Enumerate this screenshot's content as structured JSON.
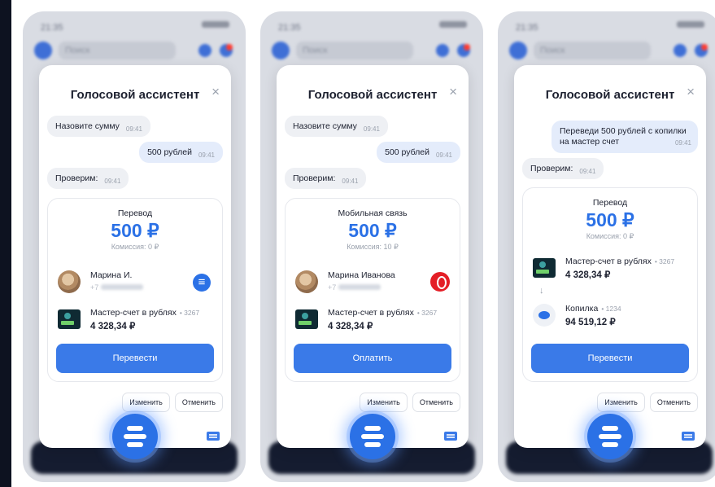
{
  "colors": {
    "accent": "#2b71e6",
    "button": "#3a7ae8",
    "background_frame": "#0d1220"
  },
  "screens": [
    {
      "status_time": "21:35",
      "search_placeholder": "Поиск",
      "title": "Голосовой ассистент",
      "close_icon": "×",
      "messages": [
        {
          "text": "Назовите сумму",
          "time": "09:41",
          "from": "assistant"
        },
        {
          "text": "500 рублей",
          "time": "09:41",
          "from": "user"
        },
        {
          "text": "Проверим:",
          "time": "09:41",
          "from": "assistant"
        }
      ],
      "card": {
        "heading": "Перевод",
        "amount": "500 ₽",
        "fee": "Комиссия: 0 ₽",
        "recipient_name": "Марина И.",
        "recipient_phone_prefix": "+7",
        "account_name": "Мастер-счет в рублях",
        "account_mask": "• 3267",
        "account_balance": "4 328,34 ₽"
      },
      "primary_button": "Перевести",
      "edit_button": "Изменить",
      "cancel_button": "Отменить"
    },
    {
      "status_time": "21:35",
      "search_placeholder": "Поиск",
      "title": "Голосовой ассистент",
      "close_icon": "×",
      "messages": [
        {
          "text": "Назовите сумму",
          "time": "09:41",
          "from": "assistant"
        },
        {
          "text": "500 рублей",
          "time": "09:41",
          "from": "user"
        },
        {
          "text": "Проверим:",
          "time": "09:41",
          "from": "assistant"
        }
      ],
      "card": {
        "heading": "Мобильная связь",
        "amount": "500 ₽",
        "fee": "Комиссия: 10 ₽",
        "recipient_name": "Марина Иванова",
        "recipient_phone_prefix": "+7",
        "account_name": "Мастер-счет в рублях",
        "account_mask": "• 3267",
        "account_balance": "4 328,34 ₽"
      },
      "primary_button": "Оплатить",
      "edit_button": "Изменить",
      "cancel_button": "Отменить"
    },
    {
      "status_time": "21:35",
      "search_placeholder": "Поиск",
      "title": "Голосовой ассистент",
      "close_icon": "×",
      "messages": [
        {
          "text": "Переведи 500 рублей с копилки на мастер счет",
          "time": "09:41",
          "from": "user"
        },
        {
          "text": "Проверим:",
          "time": "09:41",
          "from": "assistant"
        }
      ],
      "card": {
        "heading": "Перевод",
        "amount": "500 ₽",
        "fee": "Комиссия: 0 ₽",
        "from_account_name": "Мастер-счет в рублях",
        "from_account_mask": "• 3267",
        "from_account_balance": "4 328,34 ₽",
        "to_account_name": "Копилка",
        "to_account_mask": "• 1234",
        "to_account_balance": "94 519,12 ₽"
      },
      "primary_button": "Перевести",
      "edit_button": "Изменить",
      "cancel_button": "Отменить"
    }
  ]
}
